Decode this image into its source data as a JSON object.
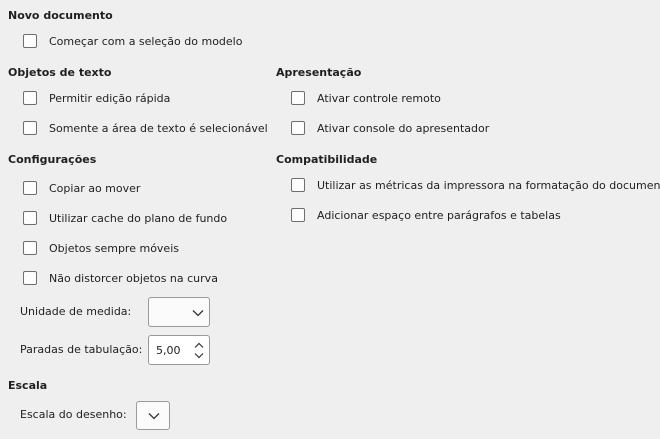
{
  "new_document": {
    "heading": "Novo documento",
    "start_with_template": "Começar com a seleção do modelo"
  },
  "text_objects": {
    "heading": "Objetos de texto",
    "quick_edit": "Permitir edição rápida",
    "only_text_area": "Somente a área de texto é selecionável"
  },
  "presentation": {
    "heading": "Apresentação",
    "remote_control": "Ativar controle remoto",
    "presenter_console": "Ativar console do apresentador"
  },
  "settings": {
    "heading": "Configurações",
    "copy_on_move": "Copiar ao mover",
    "background_cache": "Utilizar cache do plano de fundo",
    "objects_movable": "Objetos sempre móveis",
    "no_distort_curve": "Não distorcer objetos na curva",
    "unit_label": "Unidade de medida:",
    "unit_value": "",
    "tab_stops_label": "Paradas de tabulação:",
    "tab_stops_value": "5,00"
  },
  "compatibility": {
    "heading": "Compatibilidade",
    "printer_metrics": "Utilizar as métricas da impressora na formatação do documento",
    "add_spacing": "Adicionar espaço entre parágrafos e tabelas"
  },
  "scale": {
    "heading": "Escala",
    "drawing_scale_label": "Escala do desenho:",
    "drawing_scale_value": ""
  },
  "checkbox_states": {
    "start_with_template": false,
    "quick_edit": false,
    "only_text_area": false,
    "remote_control": false,
    "presenter_console": false,
    "copy_on_move": false,
    "background_cache": false,
    "objects_movable": false,
    "no_distort_curve": false,
    "printer_metrics": false,
    "add_spacing": false
  }
}
